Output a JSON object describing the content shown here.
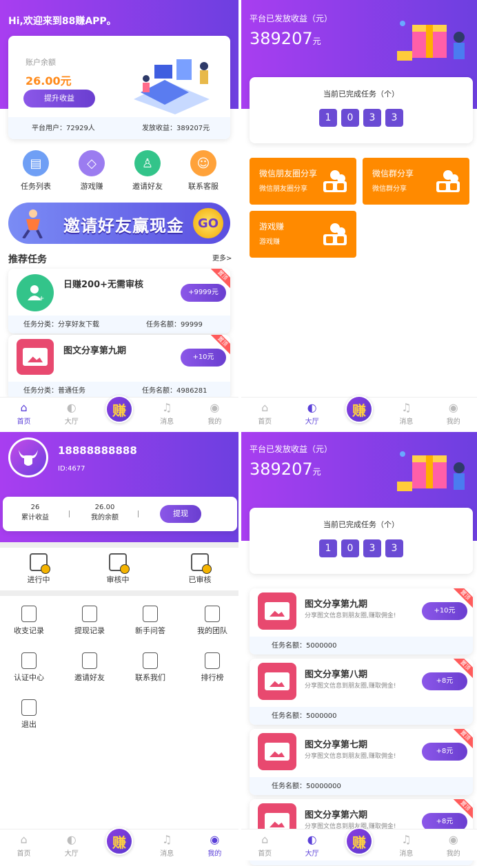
{
  "p1": {
    "greeting": "Hi,欢迎来到88赚APP。",
    "balance_label": "账户余额",
    "balance_value": "26.00元",
    "boost_button": "提升收益",
    "platform_users": "平台用户：72929人",
    "issued_earnings": "发放收益：389207元",
    "icons": [
      {
        "label": "任务列表",
        "icon": "clipboard-icon",
        "color": "#6f9ff5"
      },
      {
        "label": "游戏赚",
        "icon": "diamond-icon",
        "color": "#9b7cf0"
      },
      {
        "label": "邀请好友",
        "icon": "add-user-icon",
        "color": "#33c48a"
      },
      {
        "label": "联系客服",
        "icon": "smile-icon",
        "color": "#ffa23a"
      }
    ],
    "banner_text": "邀请好友赢现金",
    "banner_go": "GO",
    "rec_title": "推荐任务",
    "more": "更多>",
    "tasks": [
      {
        "title": "日赚200+无需审核",
        "reward": "+9999元",
        "cat": "任务分类：分享好友下载",
        "quota": "任务名额：99999",
        "ribbon": "置顶"
      },
      {
        "title": "图文分享第九期",
        "reward": "+10元",
        "cat": "任务分类：普通任务",
        "quota": "任务名额：4986281",
        "ribbon": "置顶"
      }
    ]
  },
  "p2": {
    "issued_label": "平台已发放收益（元）",
    "issued_value": "389207",
    "issued_unit": "元",
    "completed_label": "当前已完成任务（个）",
    "digits": [
      "1",
      "0",
      "3",
      "3"
    ],
    "games": [
      {
        "t1": "微信朋友圈分享",
        "t2": "微信朋友圈分享"
      },
      {
        "t1": "微信群分享",
        "t2": "微信群分享"
      },
      {
        "t1": "游戏赚",
        "t2": "游戏赚"
      }
    ]
  },
  "p3": {
    "phone": "18888888888",
    "id": "ID:4677",
    "total_earn": "26",
    "total_earn_label": "累计收益",
    "my_balance": "26.00",
    "my_balance_label": "我的余额",
    "withdraw": "提现",
    "status": [
      {
        "label": "进行中",
        "icon": "in-progress-icon",
        "color": "#f5b400"
      },
      {
        "label": "审核中",
        "icon": "reviewing-icon",
        "color": "#f5b400"
      },
      {
        "label": "已审核",
        "icon": "reviewed-icon",
        "color": "#f5b400"
      }
    ],
    "menu": [
      {
        "label": "收支记录",
        "icon": "ledger-icon"
      },
      {
        "label": "提现记录",
        "icon": "withdraw-record-icon"
      },
      {
        "label": "新手问答",
        "icon": "paper-plane-icon"
      },
      {
        "label": "我的团队",
        "icon": "team-icon"
      },
      {
        "label": "认证中心",
        "icon": "certificate-icon"
      },
      {
        "label": "邀请好友",
        "icon": "invite-icon"
      },
      {
        "label": "联系我们",
        "icon": "contact-icon"
      },
      {
        "label": "排行榜",
        "icon": "ranking-icon"
      },
      {
        "label": "退出",
        "icon": "logout-icon"
      }
    ]
  },
  "p4": {
    "issued_label": "平台已发放收益（元）",
    "issued_value": "389207",
    "issued_unit": "元",
    "completed_label": "当前已完成任务（个）",
    "digits": [
      "1",
      "0",
      "3",
      "3"
    ],
    "tasks": [
      {
        "title": "图文分享第九期",
        "desc": "分享图文信息到朋友圈,赚取佣金!",
        "reward": "+10元",
        "quota": "任务名额：5000000",
        "ribbon": "置顶"
      },
      {
        "title": "图文分享第八期",
        "desc": "分享图文信息到朋友圈,赚取佣金!",
        "reward": "+8元",
        "quota": "任务名额：5000000",
        "ribbon": "置顶"
      },
      {
        "title": "图文分享第七期",
        "desc": "分享图文信息到朋友圈,赚取佣金!",
        "reward": "+8元",
        "quota": "任务名额：50000000",
        "ribbon": "置顶"
      },
      {
        "title": "图文分享第六期",
        "desc": "分享图文信息到朋友圈,赚取佣金!",
        "reward": "+8元",
        "quota": "",
        "ribbon": "置顶"
      }
    ]
  },
  "tabbar": {
    "home": "首页",
    "hall": "大厅",
    "earn": "赚",
    "msg": "消息",
    "mine": "我的"
  }
}
